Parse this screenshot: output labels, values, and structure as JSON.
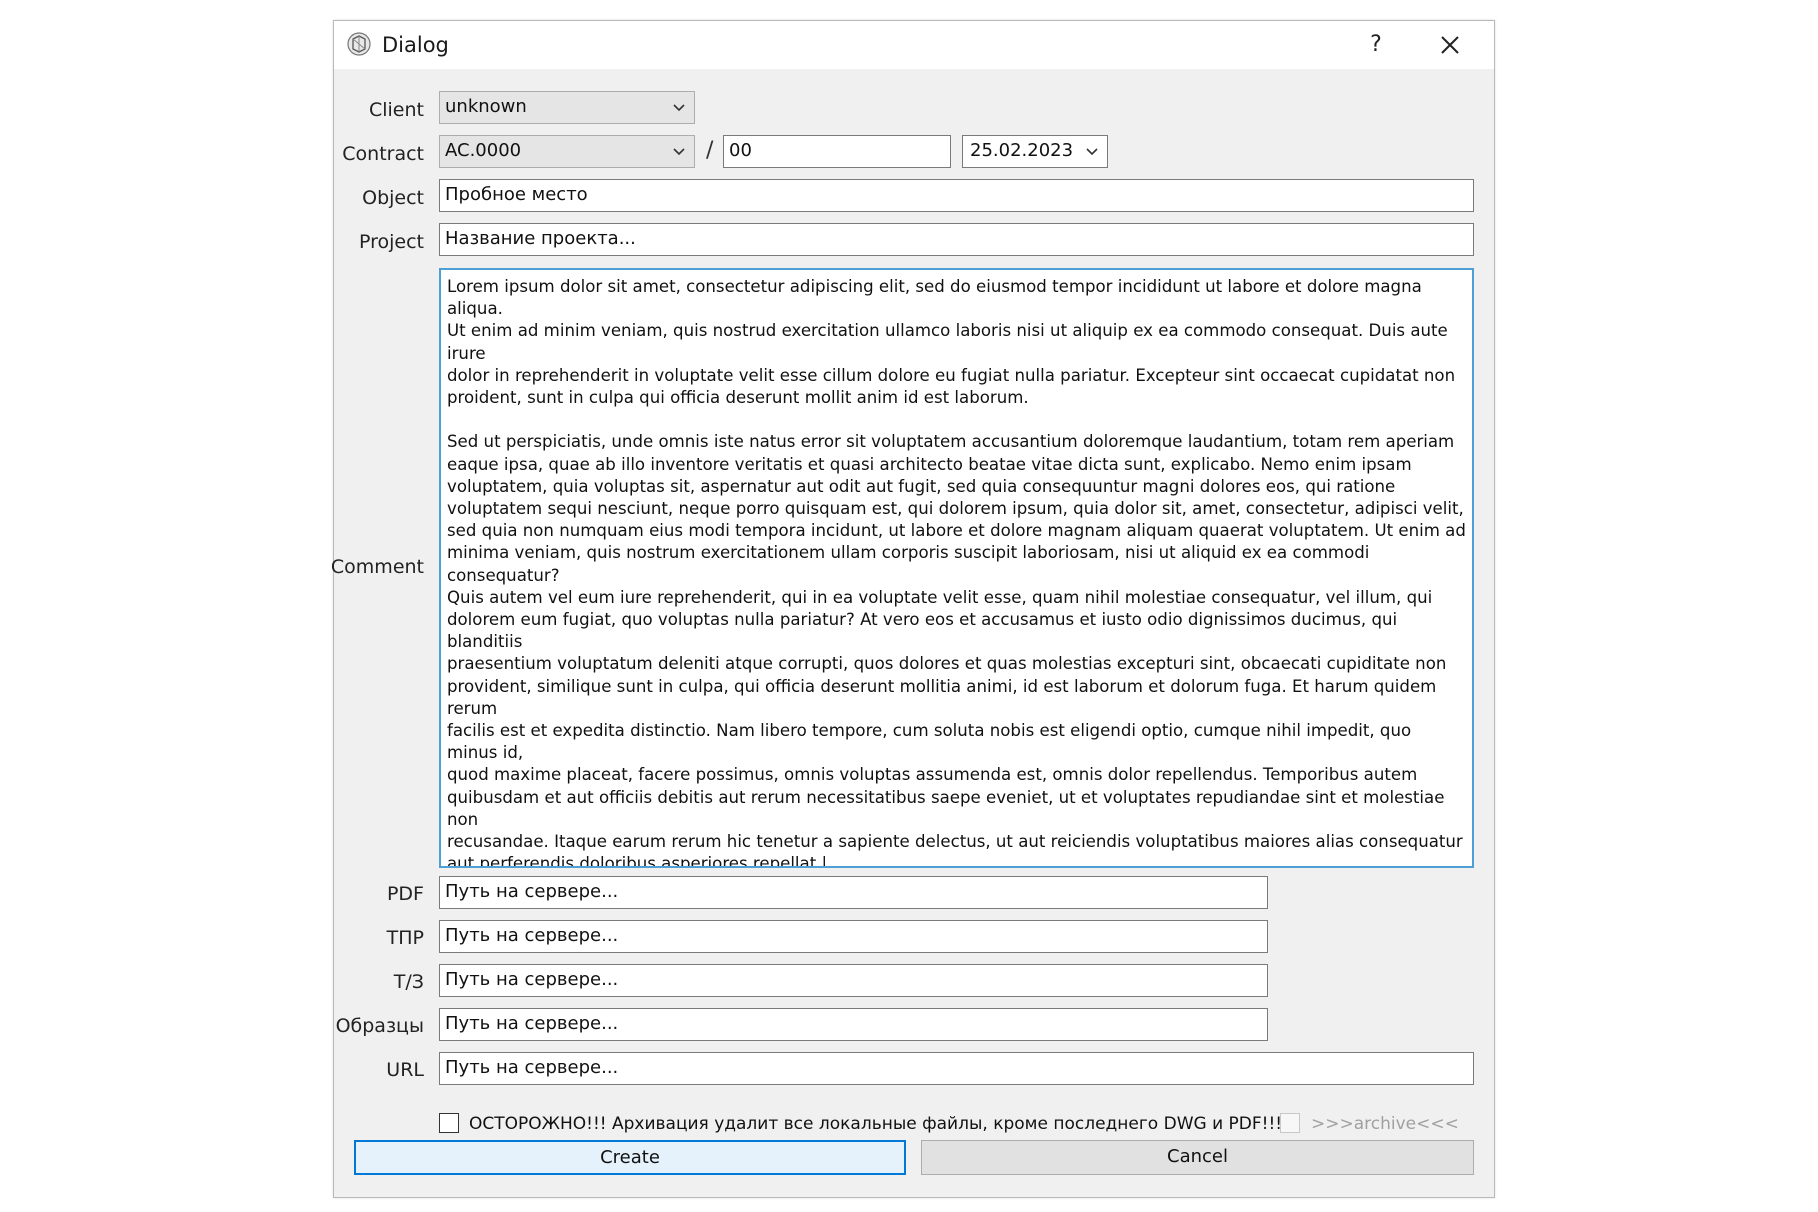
{
  "window": {
    "title": "Dialog",
    "help_label": "?"
  },
  "form": {
    "client": {
      "label": "Client",
      "value": "unknown"
    },
    "contract": {
      "label": "Contract",
      "value": "AC.0000",
      "separator": "/",
      "number": "00",
      "date": "25.02.2023"
    },
    "object": {
      "label": "Object",
      "value": "Пробное место"
    },
    "project": {
      "label": "Project",
      "value": "Название проекта..."
    },
    "comment": {
      "label": "Comment",
      "value": "Lorem ipsum dolor sit amet, consectetur adipiscing elit, sed do eiusmod tempor incididunt ut labore et dolore magna aliqua.\nUt enim ad minim veniam, quis nostrud exercitation ullamco laboris nisi ut aliquip ex ea commodo consequat. Duis aute irure\ndolor in reprehenderit in voluptate velit esse cillum dolore eu fugiat nulla pariatur. Excepteur sint occaecat cupidatat non\nproident, sunt in culpa qui officia deserunt mollit anim id est laborum.\n\nSed ut perspiciatis, unde omnis iste natus error sit voluptatem accusantium doloremque laudantium, totam rem aperiam\neaque ipsa, quae ab illo inventore veritatis et quasi architecto beatae vitae dicta sunt, explicabo. Nemo enim ipsam\nvoluptatem, quia voluptas sit, aspernatur aut odit aut fugit, sed quia consequuntur magni dolores eos, qui ratione\nvoluptatem sequi nesciunt, neque porro quisquam est, qui dolorem ipsum, quia dolor sit, amet, consectetur, adipisci velit,\nsed quia non numquam eius modi tempora incidunt, ut labore et dolore magnam aliquam quaerat voluptatem. Ut enim ad\nminima veniam, quis nostrum exercitationem ullam corporis suscipit laboriosam, nisi ut aliquid ex ea commodi consequatur?\nQuis autem vel eum iure reprehenderit, qui in ea voluptate velit esse, quam nihil molestiae consequatur, vel illum, qui\ndolorem eum fugiat, quo voluptas nulla pariatur? At vero eos et accusamus et iusto odio dignissimos ducimus, qui blanditiis\npraesentium voluptatum deleniti atque corrupti, quos dolores et quas molestias excepturi sint, obcaecati cupiditate non\nprovident, similique sunt in culpa, qui officia deserunt mollitia animi, id est laborum et dolorum fuga. Et harum quidem rerum\nfacilis est et expedita distinctio. Nam libero tempore, cum soluta nobis est eligendi optio, cumque nihil impedit, quo minus id,\nquod maxime placeat, facere possimus, omnis voluptas assumenda est, omnis dolor repellendus. Temporibus autem\nquibusdam et aut officiis debitis aut rerum necessitatibus saepe eveniet, ut et voluptates repudiandae sint et molestiae non\nrecusandae. Itaque earum rerum hic tenetur a sapiente delectus, ut aut reiciendis voluptatibus maiores alias consequatur\naut perferendis doloribus asperiores repellat.|"
    },
    "pdf": {
      "label": "PDF",
      "value": "Путь на сервере..."
    },
    "tpr": {
      "label": "ТПР",
      "value": "Путь на сервере..."
    },
    "tz": {
      "label": "Т/З",
      "value": "Путь на сервере..."
    },
    "samples": {
      "label": "Образцы",
      "value": "Путь на сервере..."
    },
    "url": {
      "label": "URL",
      "value": "Путь на сервере..."
    },
    "warning": {
      "text": "ОСТОРОЖНО!!! Архивация удалит все локальные файлы, кроме последнего DWG и PDF!!!",
      "checked": false
    },
    "archive": {
      "text": ">>>archive<<<",
      "checked": false,
      "enabled": false
    }
  },
  "buttons": {
    "create": "Create",
    "cancel": "Cancel"
  },
  "colors": {
    "focus_border": "#4d9fd6",
    "default_button_border": "#0078d7"
  }
}
